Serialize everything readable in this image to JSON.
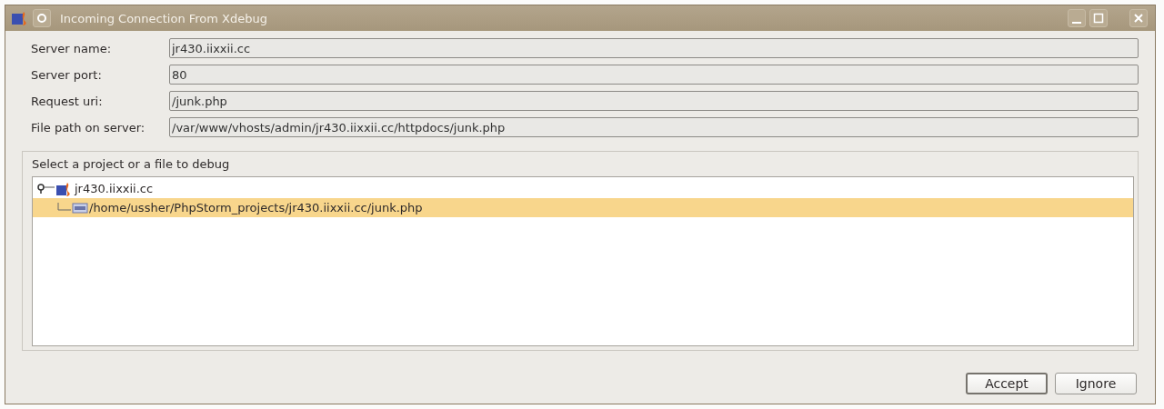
{
  "window": {
    "title": "Incoming Connection From Xdebug"
  },
  "fields": [
    {
      "label": "Server name:",
      "value": "jr430.iixxii.cc"
    },
    {
      "label": "Server port:",
      "value": "80"
    },
    {
      "label": "Request uri:",
      "value": "/junk.php"
    },
    {
      "label": "File path on server:",
      "value": "/var/www/vhosts/admin/jr430.iixxii.cc/httpdocs/junk.php"
    }
  ],
  "tree": {
    "title": "Select a project or a file to debug",
    "items": [
      {
        "label": "jr430.iixxii.cc",
        "kind": "project",
        "expanded": true,
        "selected": false,
        "children": [
          {
            "label": "/home/ussher/PhpStorm_projects/jr430.iixxii.cc/junk.php",
            "kind": "file",
            "selected": true
          }
        ]
      }
    ]
  },
  "buttons": [
    {
      "label": "Accept",
      "default": true
    },
    {
      "label": "Ignore",
      "default": false
    }
  ]
}
